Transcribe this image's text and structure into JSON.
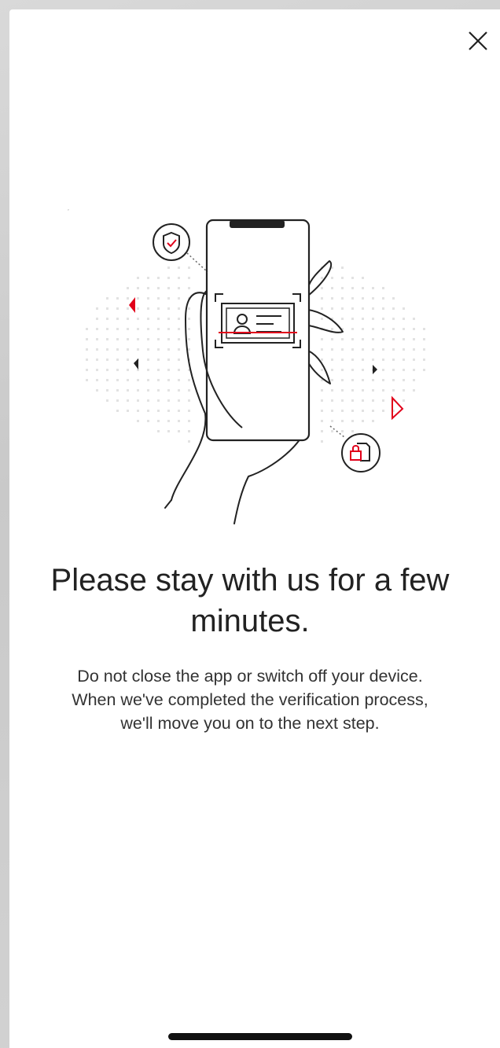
{
  "header": {
    "close_icon": "close-icon"
  },
  "illustration": {
    "description_icons": [
      "shield-check-icon",
      "lock-document-icon",
      "id-card-icon"
    ],
    "accent_color": "#e1001a"
  },
  "main": {
    "headline": "Please stay with us for a few minutes.",
    "body_line1": "Do not close the app or switch off your device.",
    "body_line2": "When we've completed the verification process,",
    "body_line3": "we'll move you on to the next step."
  }
}
